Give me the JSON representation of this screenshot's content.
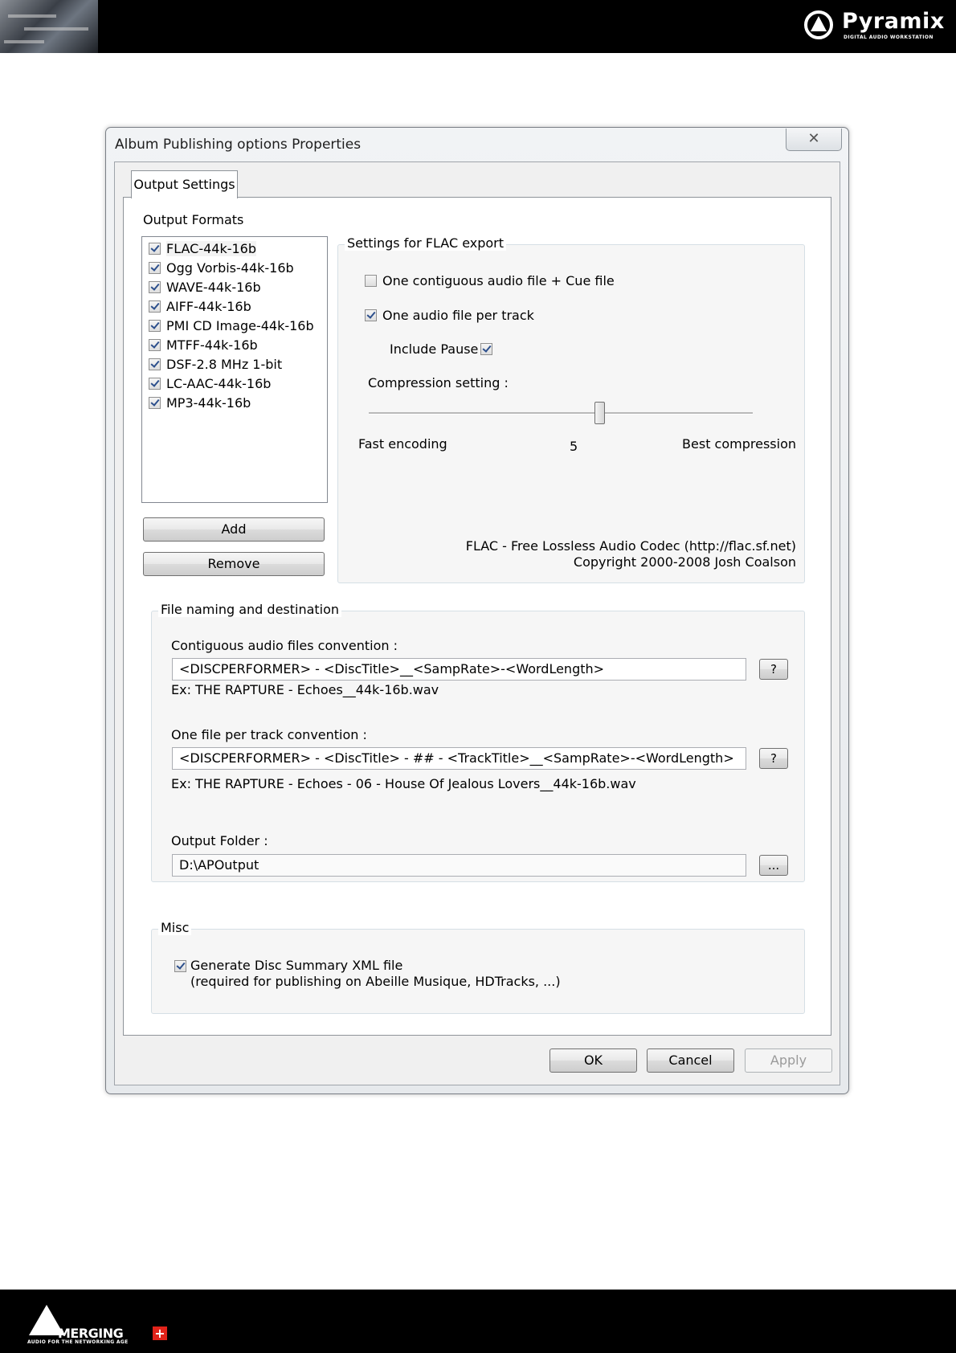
{
  "header": {
    "brand_name": "Pyramix",
    "brand_tagline": "DIGITAL AUDIO WORKSTATION"
  },
  "footer": {
    "brand_name": "MERGING",
    "brand_tagline": "AUDIO FOR THE NETWORKING AGE"
  },
  "dialog": {
    "title": "Album Publishing options Properties",
    "close_glyph": "✕",
    "tab_label": "Output Settings",
    "output_formats": {
      "label": "Output Formats",
      "items": [
        {
          "label": "FLAC-44k-16b",
          "checked": true
        },
        {
          "label": "Ogg Vorbis-44k-16b",
          "checked": true
        },
        {
          "label": "WAVE-44k-16b",
          "checked": true
        },
        {
          "label": "AIFF-44k-16b",
          "checked": true
        },
        {
          "label": "PMI CD Image-44k-16b",
          "checked": true
        },
        {
          "label": "MTFF-44k-16b",
          "checked": true
        },
        {
          "label": "DSF-2.8 MHz 1-bit",
          "checked": true
        },
        {
          "label": "LC-AAC-44k-16b",
          "checked": true
        },
        {
          "label": "MP3-44k-16b",
          "checked": true
        }
      ],
      "add_label": "Add",
      "remove_label": "Remove"
    },
    "flac_settings": {
      "title": "Settings for FLAC export",
      "contiguous_label": "One contiguous audio file + Cue file",
      "contiguous_checked": false,
      "per_track_label": "One audio file per track",
      "per_track_checked": true,
      "include_pause_label": "Include Pause",
      "include_pause_checked": true,
      "compression_label": "Compression setting :",
      "compression_min_label": "Fast encoding",
      "compression_max_label": "Best compression",
      "compression_value": "5",
      "credit_line1": "FLAC - Free Lossless Audio Codec (http://flac.sf.net)",
      "credit_line2": "Copyright 2000-2008 Josh Coalson"
    },
    "file_naming": {
      "title": "File naming and destination",
      "contiguous_label": "Contiguous audio files convention :",
      "contiguous_value": "<DISCPERFORMER> - <DiscTitle>__<SampRate>-<WordLength>",
      "contiguous_example": "Ex: THE RAPTURE - Echoes__44k-16b.wav",
      "per_track_label": "One file per track convention :",
      "per_track_value": "<DISCPERFORMER> - <DiscTitle> - ## - <TrackTitle>__<SampRate>-<WordLength>",
      "per_track_example": "Ex: THE RAPTURE - Echoes - 06 - House Of Jealous Lovers__44k-16b.wav",
      "help_label": "?",
      "output_folder_label": "Output Folder :",
      "output_folder_value": "D:\\APOutput",
      "browse_label": "..."
    },
    "misc": {
      "title": "Misc",
      "generate_label": "Generate Disc Summary XML file",
      "generate_note": "(required for publishing on Abeille Musique, HDTracks, ...)",
      "generate_checked": true
    },
    "buttons": {
      "ok": "OK",
      "cancel": "Cancel",
      "apply": "Apply"
    }
  }
}
